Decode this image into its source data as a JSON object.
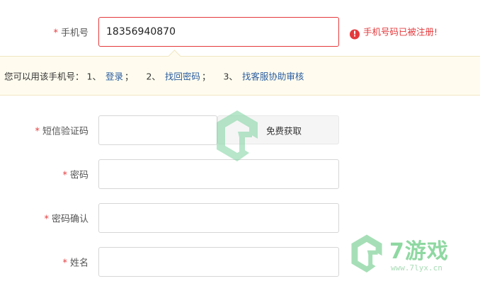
{
  "form": {
    "phone": {
      "label": "手机号",
      "value": "18356940870",
      "error": "手机号码已被注册!"
    },
    "hint": {
      "prefix": "您可以用该手机号：",
      "item1_num": "1、",
      "item1_link": "登录",
      "item1_sep": "；",
      "item2_num": "2、",
      "item2_link": "找回密码",
      "item2_sep": "；",
      "item3_num": "3、",
      "item3_link": "找客服协助审核"
    },
    "sms": {
      "label": "短信验证码",
      "value": "",
      "button": "免费获取"
    },
    "password": {
      "label": "密码",
      "value": ""
    },
    "password_confirm": {
      "label": "密码确认",
      "value": ""
    },
    "name": {
      "label": "姓名",
      "value": ""
    },
    "required_mark": "*"
  },
  "watermark": {
    "brand": "7游戏",
    "url": "www.7lyx.cn"
  },
  "colors": {
    "error": "#e4393c",
    "link": "#2a5d9f",
    "hint_bg": "#fffcef",
    "watermark": "#8fd8a2"
  },
  "icons": {
    "error": "exclamation-circle-icon",
    "watermark": "hexagon-logo-icon"
  }
}
